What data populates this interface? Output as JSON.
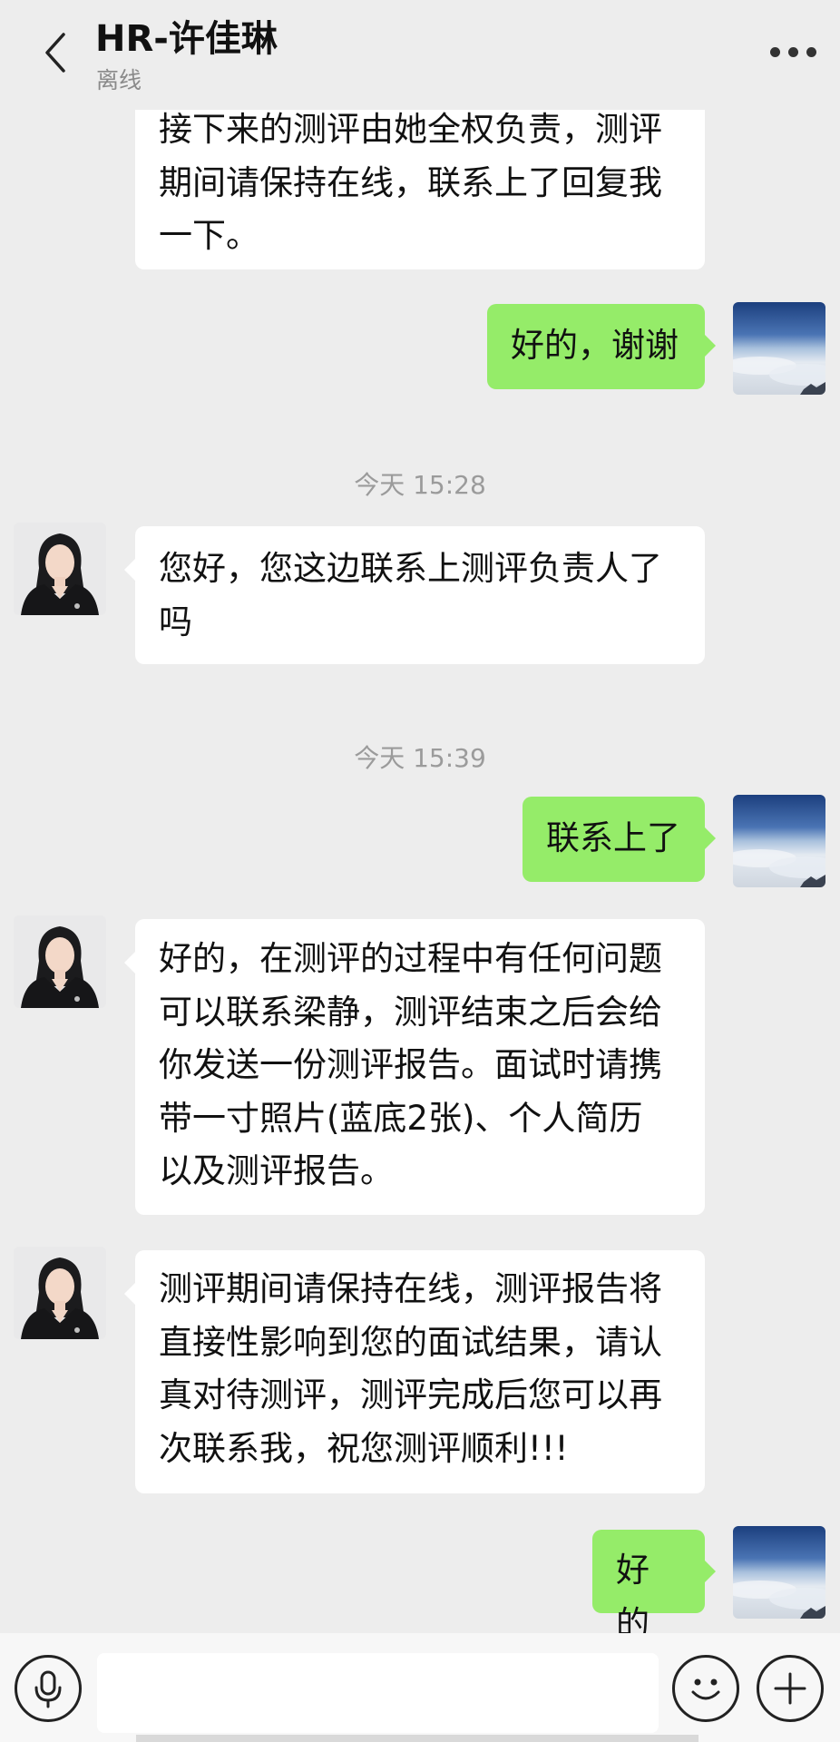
{
  "header": {
    "title": "HR-许佳琳",
    "status": "离线"
  },
  "messages": [
    {
      "side": "in",
      "text": "接下来的测评由她全权负责，测评\n期间请保持在线，联系上了回复我\n一下。"
    },
    {
      "side": "out",
      "text": "好的，谢谢"
    },
    {
      "type": "time",
      "text": "今天 15:28"
    },
    {
      "side": "in",
      "text": "您好，您这边联系上测评负责人了\n吗"
    },
    {
      "type": "time",
      "text": "今天 15:39"
    },
    {
      "side": "out",
      "text": "联系上了"
    },
    {
      "side": "in",
      "text": "好的，在测评的过程中有任何问题\n可以联系梁静，测评结束之后会给\n你发送一份测评报告。面试时请携\n带一寸照片(蓝底2张)、个人简历\n以及测评报告。"
    },
    {
      "side": "in",
      "text": "测评期间请保持在线，测评报告将\n直接性影响到您的面试结果，请认\n真对待测评，测评完成后您可以再\n次联系我，祝您测评顺利!!!"
    },
    {
      "side": "out",
      "text": "好的"
    }
  ],
  "icons": {
    "back": "chevron-left-icon",
    "more": "more-dots-icon",
    "voice": "microphone-icon",
    "emoji": "smiley-icon",
    "add": "plus-icon"
  },
  "colors": {
    "background": "#ededed",
    "incoming_bubble": "#ffffff",
    "outgoing_bubble": "#95ec69"
  }
}
